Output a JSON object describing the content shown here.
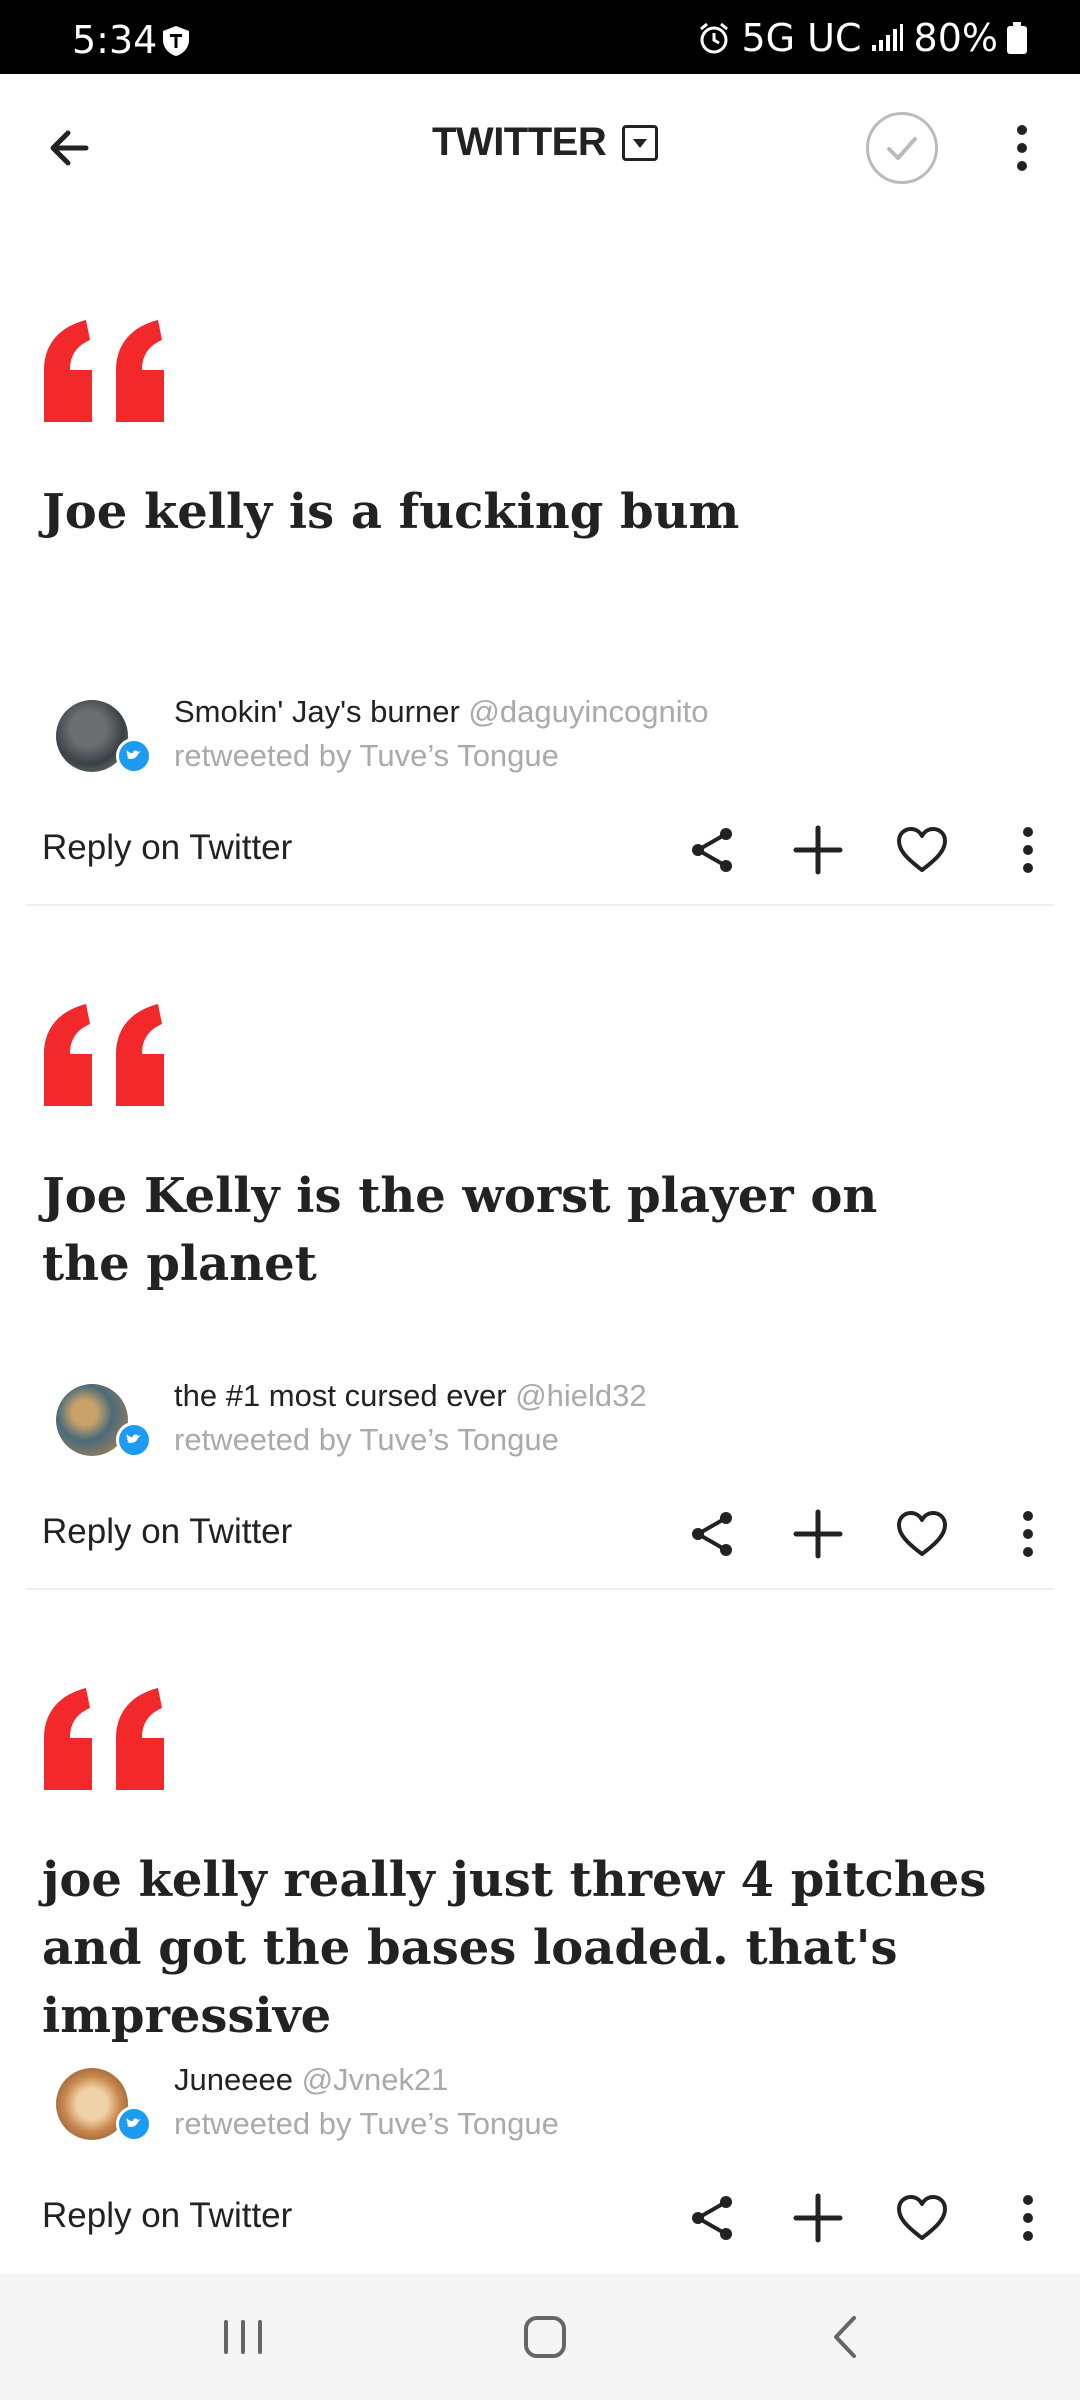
{
  "status_bar": {
    "time": "5:34",
    "network": "5G UC",
    "battery": "80%",
    "icons": [
      "carrier-shield-icon",
      "alarm-icon",
      "signal-icon",
      "battery-icon"
    ]
  },
  "header": {
    "title": "TWITTER",
    "icons": [
      "back-arrow-icon",
      "dropdown-icon",
      "check-circle-icon",
      "more-vertical-icon"
    ]
  },
  "cards": [
    {
      "quote": "Joe kelly is a fucking bum",
      "author_name": "Smokin' Jay's burner",
      "handle": "@daguyincognito",
      "retweeted_by": "retweeted by Tuve’s Tongue",
      "reply_label": "Reply on Twitter"
    },
    {
      "quote": "Joe Kelly is the worst player on the planet",
      "author_name": "the #1 most cursed ever",
      "handle": "@hield32",
      "retweeted_by": "retweeted by Tuve’s Tongue",
      "reply_label": "Reply on Twitter"
    },
    {
      "quote": "joe kelly really just threw 4 pitches and got the bases loaded. that's impressive",
      "author_name": "Juneeee",
      "handle": "@Jvnek21",
      "retweeted_by": "retweeted by Tuve’s Tongue",
      "reply_label": "Reply on Twitter"
    }
  ],
  "card_actions": [
    "share-icon",
    "add-icon",
    "heart-icon",
    "more-vertical-icon"
  ],
  "nav_bar": [
    "recent-apps-icon",
    "home-icon",
    "back-icon"
  ],
  "colors": {
    "quote_mark": "#f2282a",
    "twitter_badge": "#1d9bf0",
    "muted_text": "#aaaaaa",
    "status_bar_bg": "#000000"
  }
}
